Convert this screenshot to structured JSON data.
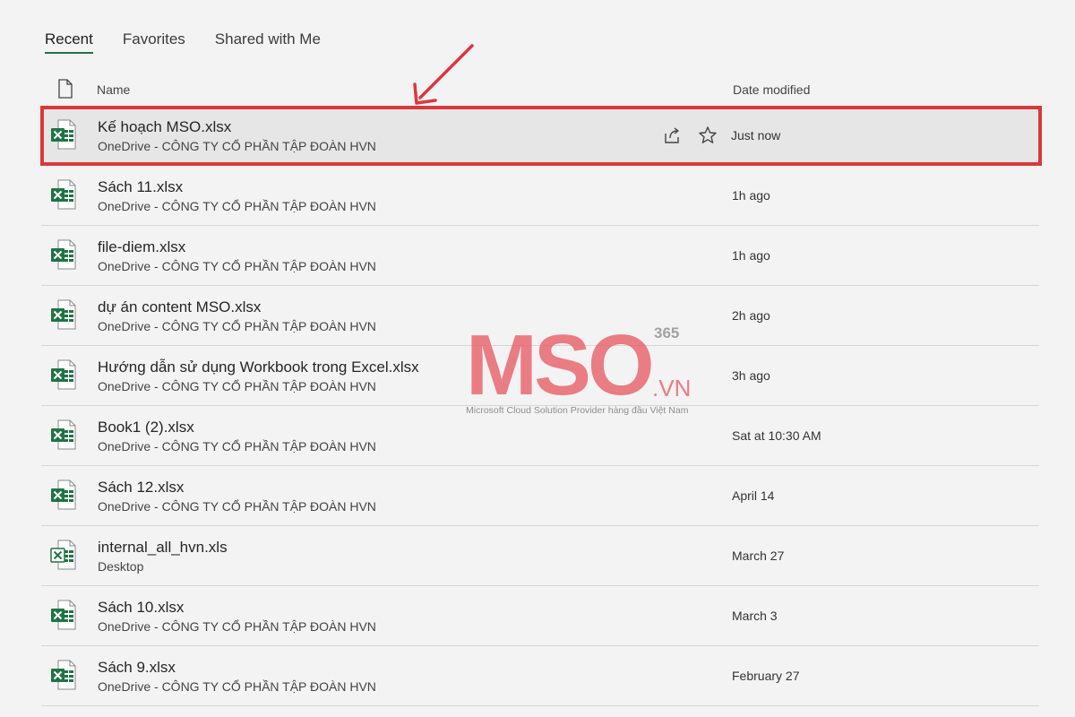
{
  "tabs": [
    {
      "label": "Recent",
      "active": true
    },
    {
      "label": "Favorites",
      "active": false
    },
    {
      "label": "Shared with Me",
      "active": false
    }
  ],
  "columns": {
    "name": "Name",
    "date": "Date modified"
  },
  "files": [
    {
      "name": "Kế hoạch MSO.xlsx",
      "location": "OneDrive - CÔNG TY CỔ PHẦN TẬP ĐOÀN HVN",
      "date": "Just now",
      "type": "xlsx"
    },
    {
      "name": "Sách 11.xlsx",
      "location": "OneDrive - CÔNG TY CỔ PHẦN TẬP ĐOÀN HVN",
      "date": "1h ago",
      "type": "xlsx"
    },
    {
      "name": "file-diem.xlsx",
      "location": "OneDrive - CÔNG TY CỔ PHẦN TẬP ĐOÀN HVN",
      "date": "1h ago",
      "type": "xlsx"
    },
    {
      "name": "dự án content MSO.xlsx",
      "location": "OneDrive - CÔNG TY CỔ PHẦN TẬP ĐOÀN HVN",
      "date": "2h ago",
      "type": "xlsx"
    },
    {
      "name": "Hướng dẫn sử dụng Workbook trong Excel.xlsx",
      "location": "OneDrive - CÔNG TY CỔ PHẦN TẬP ĐOÀN HVN",
      "date": "3h ago",
      "type": "xlsx"
    },
    {
      "name": "Book1 (2).xlsx",
      "location": "OneDrive - CÔNG TY CỔ PHẦN TẬP ĐOÀN HVN",
      "date": "Sat at 10:30 AM",
      "type": "xlsx"
    },
    {
      "name": "Sách 12.xlsx",
      "location": "OneDrive - CÔNG TY CỔ PHẦN TẬP ĐOÀN HVN",
      "date": "April 14",
      "type": "xlsx"
    },
    {
      "name": "internal_all_hvn.xls",
      "location": "Desktop",
      "date": "March 27",
      "type": "xls"
    },
    {
      "name": "Sách 10.xlsx",
      "location": "OneDrive - CÔNG TY CỔ PHẦN TẬP ĐOÀN HVN",
      "date": "March 3",
      "type": "xlsx"
    },
    {
      "name": "Sách 9.xlsx",
      "location": "OneDrive - CÔNG TY CỔ PHẦN TẬP ĐOÀN HVN",
      "date": "February 27",
      "type": "xlsx"
    }
  ],
  "watermark": {
    "brand": "MSO",
    "suffix": ".VN",
    "badge": "365",
    "tagline": "Microsoft Cloud Solution Provider hàng đầu Việt Nam"
  },
  "icons": {
    "document": "document-icon",
    "excel": "excel-file-icon",
    "share": "share-icon",
    "favorite": "star-icon"
  },
  "colors": {
    "excel_green": "#217346",
    "highlight_red": "#d9383e",
    "watermark_pink": "#e8555f"
  }
}
